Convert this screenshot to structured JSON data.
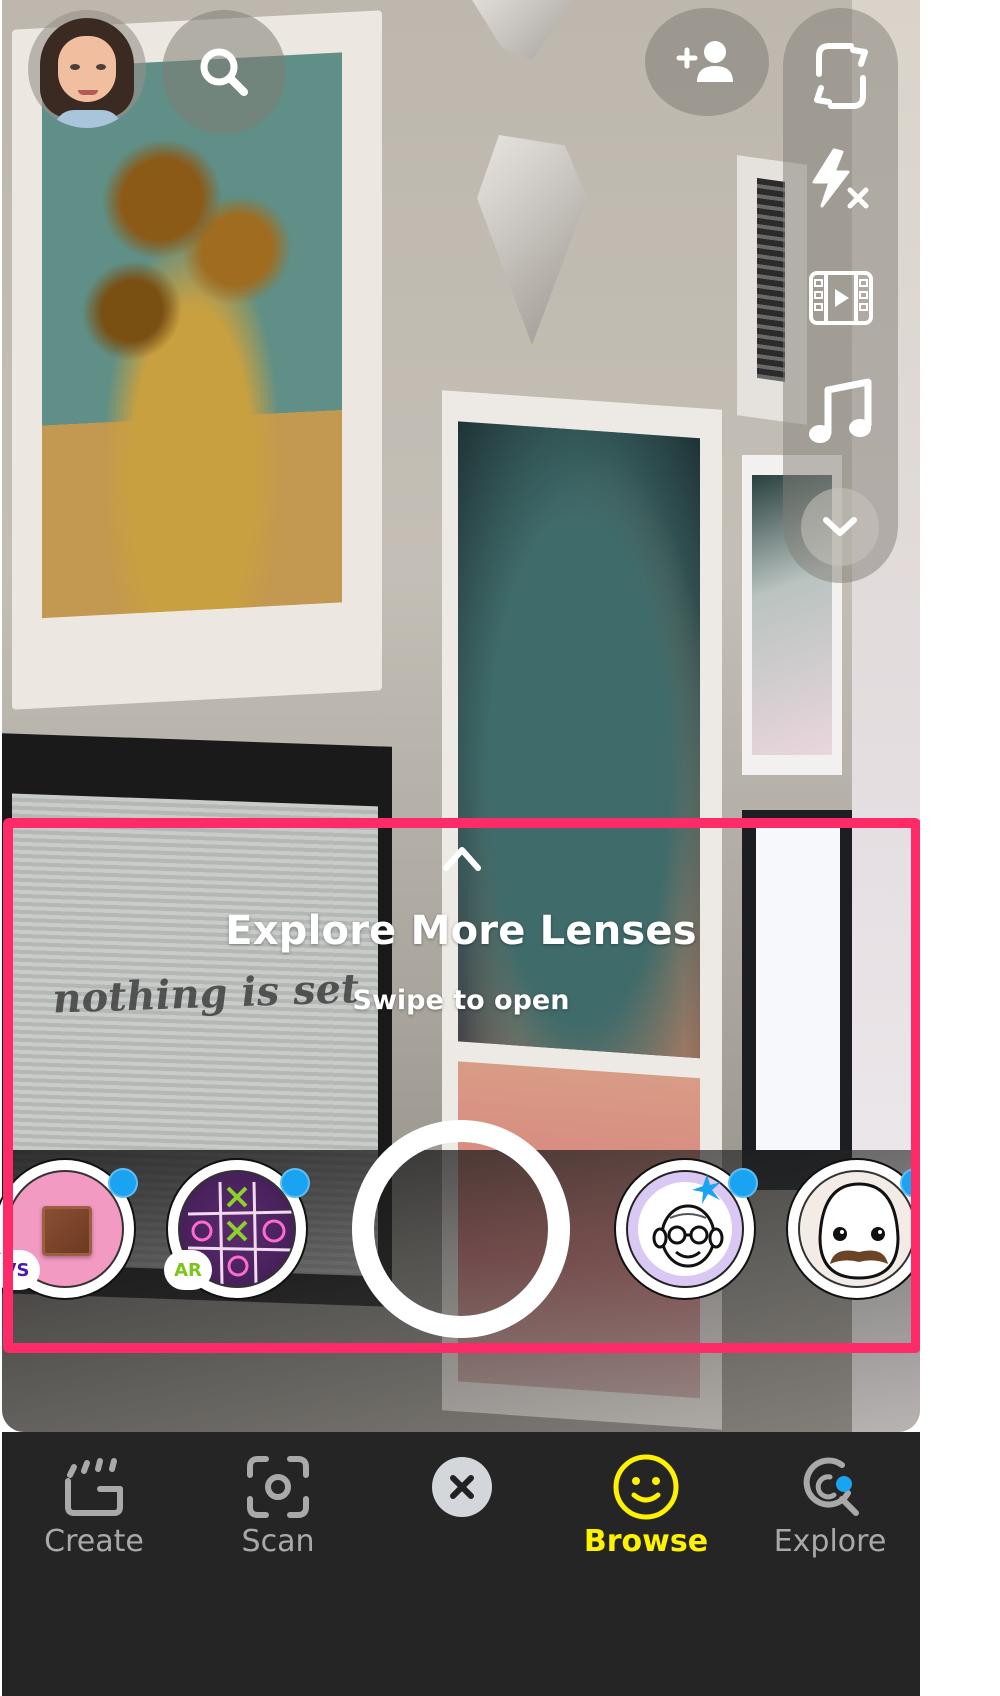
{
  "app": "Snapchat Camera",
  "header": {
    "avatar_label": "Profile Bitmoji",
    "search_icon": "search-icon",
    "add_friend_icon": "add-friend-icon"
  },
  "side_rail": {
    "items": [
      {
        "name": "flip-camera",
        "icon": "flip-camera-icon"
      },
      {
        "name": "flash-off",
        "icon": "flash-off-icon"
      },
      {
        "name": "video-mode",
        "icon": "film-play-icon"
      },
      {
        "name": "music",
        "icon": "music-note-icon"
      },
      {
        "name": "more-tools",
        "icon": "chevron-down-icon"
      }
    ]
  },
  "background_photo": {
    "poster_text": "nothing is set"
  },
  "lens_panel": {
    "title": "Explore More Lenses",
    "subtitle": "Swipe to open",
    "highlight_color": "#ff2a68",
    "lenses": [
      {
        "name": "chocolate-vs",
        "badge": "VS",
        "badge_color": "#4b1aa8",
        "is_new": true
      },
      {
        "name": "tic-tac-toe",
        "badge": "AR",
        "badge_color": "#7ec41a",
        "is_new": true
      },
      {
        "name": "old-man-face",
        "badge": "",
        "is_new": true
      },
      {
        "name": "mustache-egg",
        "badge": "",
        "is_new": true
      }
    ],
    "new_dot_color": "#1aa3f0"
  },
  "bottom_nav": {
    "items": [
      {
        "label": "Create",
        "icon": "clapperboard-icon",
        "active": false
      },
      {
        "label": "Scan",
        "icon": "scan-icon",
        "active": false
      },
      {
        "label": "",
        "icon": "close-icon",
        "active": false
      },
      {
        "label": "Browse",
        "icon": "smiley-icon",
        "active": true
      },
      {
        "label": "Explore",
        "icon": "explore-icon",
        "active": false,
        "has_notification": true
      }
    ],
    "active_color": "#fff200",
    "inactive_color": "#a9a9a9"
  }
}
